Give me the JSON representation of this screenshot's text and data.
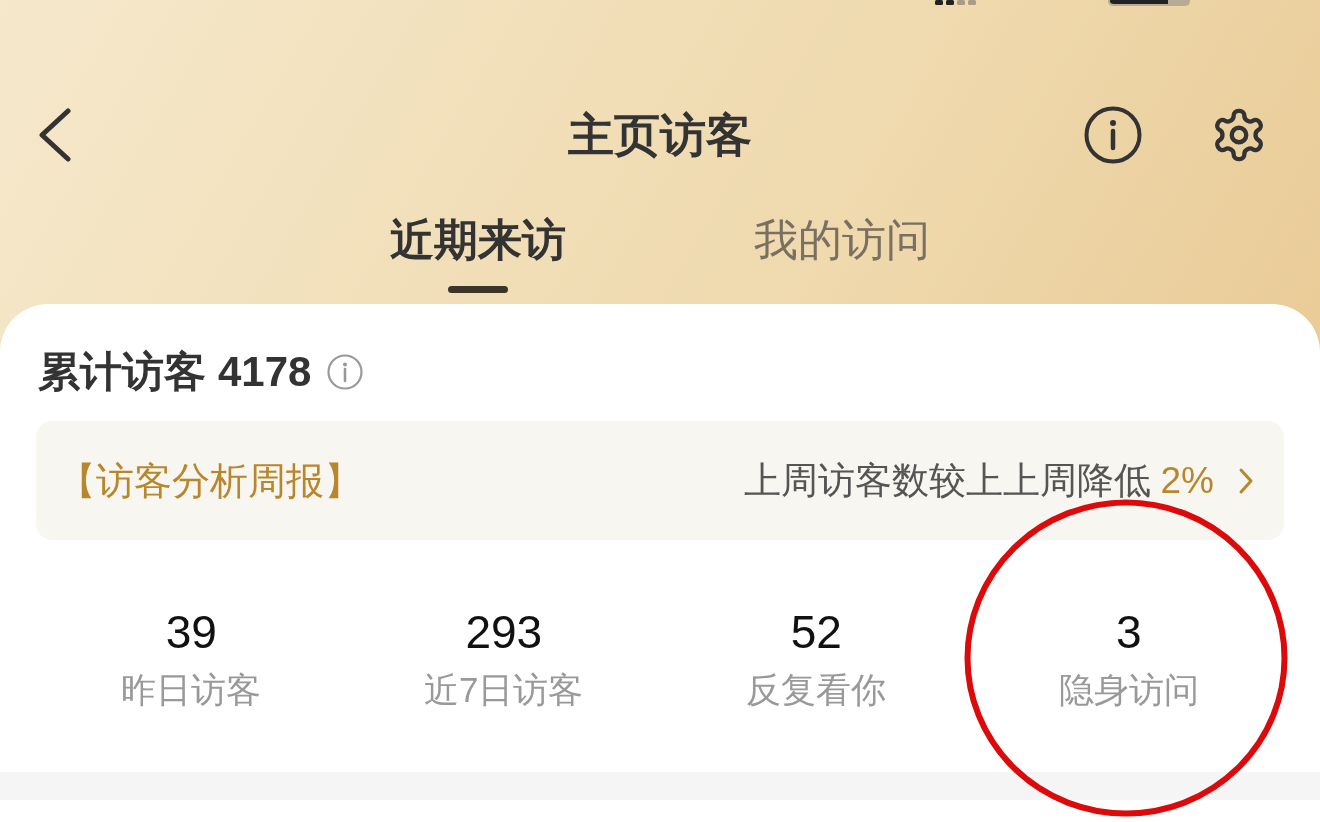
{
  "nav": {
    "title": "主页访客"
  },
  "tabs": [
    {
      "label": "近期来访",
      "selected": true
    },
    {
      "label": "我的访问",
      "selected": false
    }
  ],
  "summary": {
    "label": "累计访客",
    "count": "4178"
  },
  "weekly_report": {
    "title": "【访客分析周报】",
    "text": "上周访客数较上上周降低",
    "change": "2%"
  },
  "stats": [
    {
      "value": "39",
      "label": "昨日访客"
    },
    {
      "value": "293",
      "label": "近7日访客"
    },
    {
      "value": "52",
      "label": "反复看你"
    },
    {
      "value": "3",
      "label": "隐身访问"
    }
  ]
}
